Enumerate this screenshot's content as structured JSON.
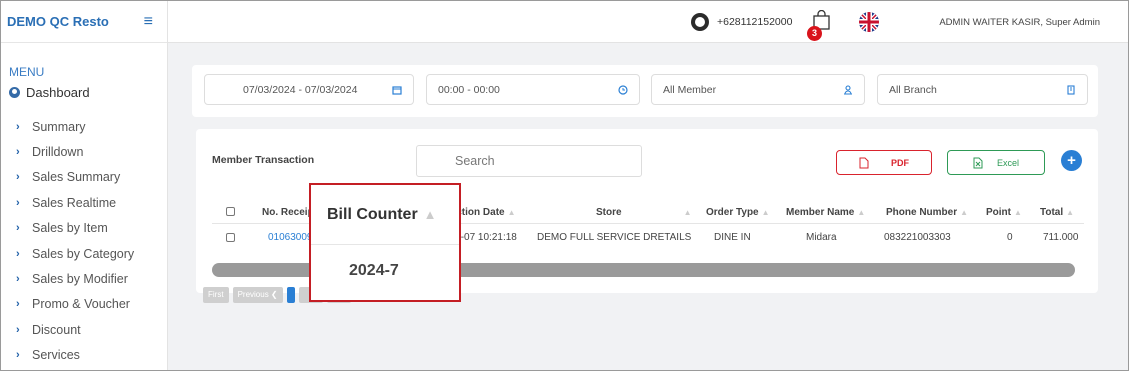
{
  "brand": {
    "name": "DEMO QC Resto",
    "menu_icon": "hamburger-icon"
  },
  "sidebar": {
    "menu_label": "MENU",
    "dashboard": "Dashboard",
    "items": [
      {
        "label": "Summary"
      },
      {
        "label": "Drilldown"
      },
      {
        "label": "Sales Summary"
      },
      {
        "label": "Sales Realtime"
      },
      {
        "label": "Sales by Item"
      },
      {
        "label": "Sales by Category"
      },
      {
        "label": "Sales by Modifier"
      },
      {
        "label": "Promo & Voucher"
      },
      {
        "label": "Discount"
      },
      {
        "label": "Services"
      }
    ]
  },
  "topbar": {
    "phone": "+628112152000",
    "cart_count": "3",
    "user": "ADMIN WAITER KASIR, Super Admin"
  },
  "filters": {
    "date_range": "07/03/2024 - 07/03/2024",
    "time_range": "00:00 - 00:00",
    "member": "All Member",
    "branch": "All Branch"
  },
  "card": {
    "title": "Member Transaction",
    "search_placeholder": "Search",
    "pdf_label": "PDF",
    "excel_label": "Excel",
    "add_label": "+"
  },
  "table": {
    "headers": {
      "receipt": "No. Receipt",
      "date": "Transaction Date",
      "store": "Store",
      "order_type": "Order Type",
      "member_name": "Member Name",
      "phone": "Phone Number",
      "point": "Point",
      "total": "Total"
    },
    "row": {
      "receipt": "01063009",
      "date": "2024-07-07 10:21:18",
      "store": "DEMO FULL SERVICE DRETAILS",
      "order_type": "DINE IN",
      "member_name": "Midara",
      "phone": "083221003303",
      "point": "0",
      "total": "711.000"
    }
  },
  "pager": {
    "first": "First",
    "previous": "Previous ❮"
  },
  "popover": {
    "header": "Bill Counter",
    "value": "2024-7"
  },
  "colors": {
    "accent": "#2a7fd4",
    "pdf": "#d9232d",
    "excel": "#2e9a56",
    "highlight": "#c41e24"
  }
}
